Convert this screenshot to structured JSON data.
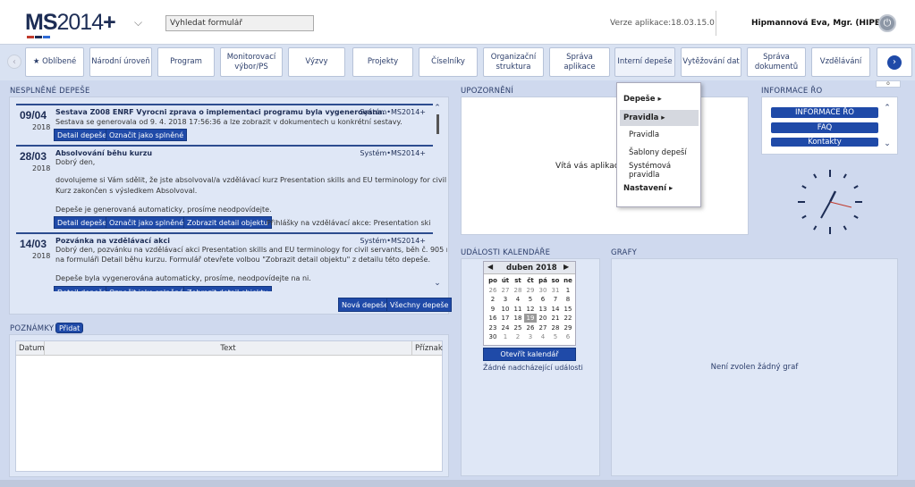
{
  "header": {
    "logo_ms": "MS",
    "logo_year": "2014",
    "logo_plus": "+",
    "search_value": "Vyhledat formulář",
    "version": "Verze aplikace:18.03.15.0",
    "user": "Hipmannová Eva, Mgr. (HIPEVA)"
  },
  "nav": {
    "items": [
      {
        "label": "★ Oblíbené"
      },
      {
        "label": "Národní úroveň"
      },
      {
        "label": "Program"
      },
      {
        "label": "Monitorovací výbor/PS"
      },
      {
        "label": "Výzvy"
      },
      {
        "label": "Projekty"
      },
      {
        "label": "Číselníky"
      },
      {
        "label": "Organizační struktura"
      },
      {
        "label": "Správa aplikace"
      },
      {
        "label": "Interní depeše"
      },
      {
        "label": "Vytěžování dat"
      },
      {
        "label": "Správa dokumentů"
      },
      {
        "label": "Vzdělávání"
      }
    ]
  },
  "depese": {
    "title": "NESPLNĚNÉ DEPEŠE",
    "messages": [
      {
        "date": "09/04",
        "year": "2018",
        "title": "Sestava Z008 ENRF Vyrocni zprava o implementaci programu byla vygenerována.",
        "sender": "Systém•MS2014+",
        "lines": [
          "Sestava se generovala od 9. 4. 2018 17:56:36 a lze zobrazit v dokumentech u konkrétní sestavy."
        ]
      },
      {
        "date": "28/03",
        "year": "2018",
        "title": "Absolvování běhu kurzu",
        "sender": "Systém•MS2014+",
        "lines": [
          "Dobrý den,",
          "dovolujeme si Vám sdělit, že jste absolvoval/a vzdělávací kurz Presentation skills and EU terminology for civil servants.",
          "Kurz zakončen s výsledkem Absolvoval.",
          "Depeše je generovaná automaticky, prosíme neodpovídejte."
        ],
        "link": "Přihlášky na vzdělávací akce: Presentation skills and EU terminology"
      },
      {
        "date": "14/03",
        "year": "2018",
        "title": "Pozvánka na vzdělávací akci",
        "sender": "Systém•MS2014+",
        "lines": [
          "Dobrý den, pozvánku na vzdělávací akci Presentation skills and EU terminology for civil servants, běh č. 905 naleznete",
          "na formuláři Detail běhu kurzu. Formulář otevřete volbou \"Zobrazit detail objektu\" z detailu této depeše.",
          "Depeše byla vygenerována automaticky, prosíme, neodpovídejte na ni."
        ]
      }
    ],
    "btn_detail": "Detail depeše",
    "btn_done": "Označit jako splněné",
    "btn_object": "Zobrazit detail objektu",
    "btn_new": "Nová depeše",
    "btn_all": "Všechny depeše"
  },
  "notes": {
    "title": "POZNÁMKY",
    "add": "Přidat",
    "columns": [
      "Datum",
      "Text",
      "Příznak"
    ]
  },
  "upozorneni": {
    "title": "UPOZORNĚNÍ",
    "text": "Vítá vás aplikace"
  },
  "dropdown": {
    "items": [
      {
        "label": "Depeše ▸"
      },
      {
        "label": "Pravidla ▸"
      },
      {
        "label": "Pravidla"
      },
      {
        "label": "Šablony depeší"
      },
      {
        "label": "Systémová pravidla"
      },
      {
        "label": "Nastavení ▸"
      }
    ]
  },
  "info": {
    "title": "INFORMACE ŘO",
    "buttons": [
      "INFORMACE ŘO",
      "FAQ",
      "Kontakty"
    ]
  },
  "calendar": {
    "title": "UDÁLOSTI KALENDÁŘE",
    "month": "duben 2018",
    "days": [
      "po",
      "út",
      "st",
      "čt",
      "pá",
      "so",
      "ne"
    ],
    "weeks": [
      [
        "26",
        "27",
        "28",
        "29",
        "30",
        "31",
        "1"
      ],
      [
        "2",
        "3",
        "4",
        "5",
        "6",
        "7",
        "8"
      ],
      [
        "9",
        "10",
        "11",
        "12",
        "13",
        "14",
        "15"
      ],
      [
        "16",
        "17",
        "18",
        "19",
        "20",
        "21",
        "22"
      ],
      [
        "23",
        "24",
        "25",
        "26",
        "27",
        "28",
        "29"
      ],
      [
        "30",
        "1",
        "2",
        "3",
        "4",
        "5",
        "6"
      ]
    ],
    "open": "Otevřít kalendář",
    "none": "Žádné nadcházející události"
  },
  "grafy": {
    "title": "GRAFY",
    "none": "Není zvolen žádný graf"
  },
  "colors": {
    "accent": "#1f4aa8",
    "navy": "#1d2d55",
    "panel": "#dfe7f6"
  }
}
